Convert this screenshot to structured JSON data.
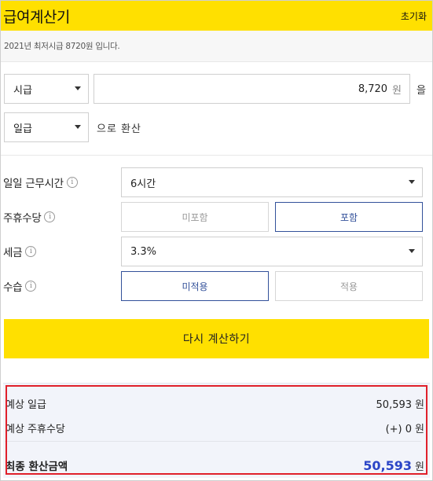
{
  "header": {
    "title": "급여계산기",
    "reset_label": "초기화"
  },
  "notice": "2021년 최저시급 8720원 입니다.",
  "converter": {
    "from_period": "시급",
    "amount": "8,720",
    "amount_unit": "원",
    "suffix": "을",
    "to_period": "일급",
    "to_suffix": "으로 환산"
  },
  "fields": {
    "daily_hours": {
      "label": "일일 근무시간",
      "value": "6시간"
    },
    "weekly_allowance": {
      "label": "주휴수당",
      "options": [
        "미포함",
        "포함"
      ],
      "selected": "포함"
    },
    "tax": {
      "label": "세금",
      "value": "3.3%"
    },
    "probation": {
      "label": "수습",
      "options": [
        "미적용",
        "적용"
      ],
      "selected": "미적용"
    }
  },
  "recalc_label": "다시 계산하기",
  "result": {
    "expected_daily_label": "예상 일급",
    "expected_daily_value": "50,593",
    "expected_allowance_label": "예상 주휴수당",
    "expected_allowance_value": "(+) 0",
    "total_label": "최종 환산금액",
    "total_value": "50,593",
    "unit": "원"
  },
  "colors": {
    "accent_yellow": "#ffe000",
    "toggle_blue": "#33519a",
    "total_blue": "#2b45c7",
    "highlight_red": "#e0202a"
  },
  "icons": {
    "info": "info-circle-icon",
    "caret": "caret-down-icon"
  }
}
